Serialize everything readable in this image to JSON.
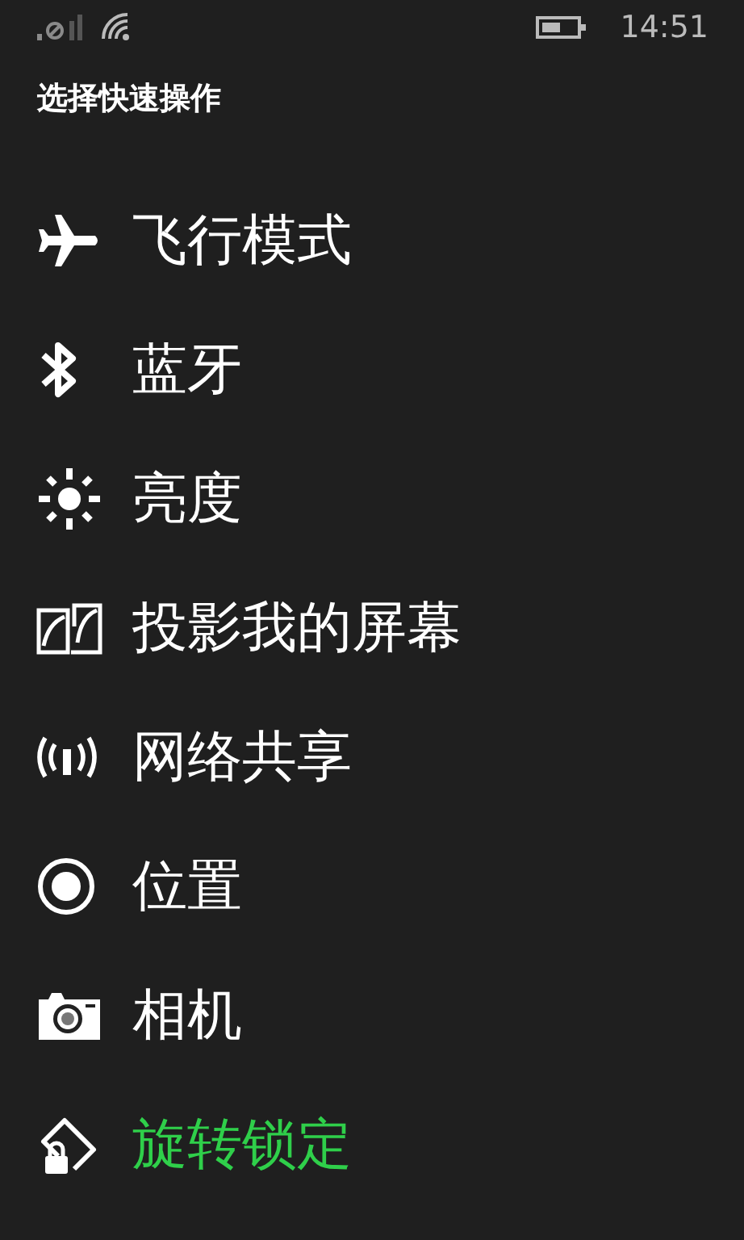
{
  "status_bar": {
    "time": "14:51"
  },
  "title": "选择快速操作",
  "actions": [
    {
      "kind": "airplane",
      "label": "飞行模式",
      "selected": false
    },
    {
      "kind": "bluetooth",
      "label": "蓝牙",
      "selected": false
    },
    {
      "kind": "brightness",
      "label": "亮度",
      "selected": false
    },
    {
      "kind": "project",
      "label": "投影我的屏幕",
      "selected": false
    },
    {
      "kind": "hotspot",
      "label": "网络共享",
      "selected": false
    },
    {
      "kind": "location",
      "label": "位置",
      "selected": false
    },
    {
      "kind": "camera",
      "label": "相机",
      "selected": false
    },
    {
      "kind": "rotation",
      "label": "旋转锁定",
      "selected": true
    }
  ]
}
